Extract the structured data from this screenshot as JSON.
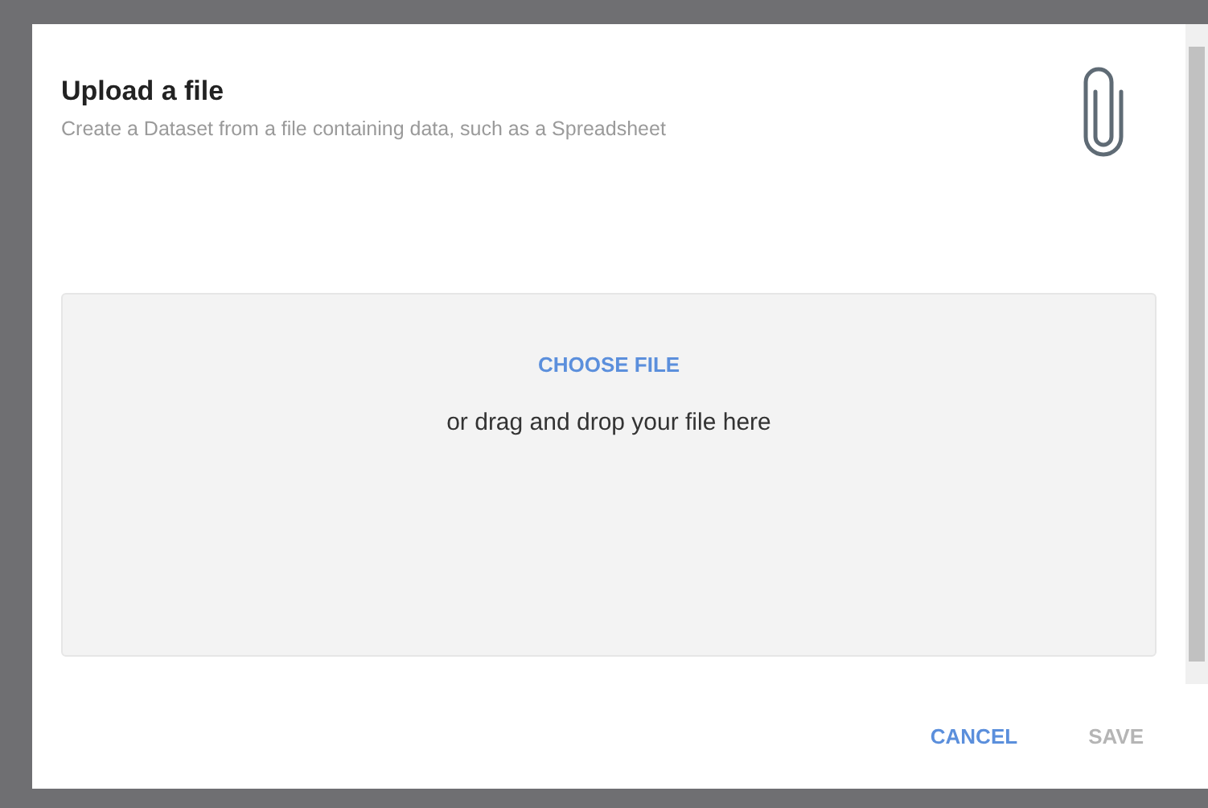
{
  "dialog": {
    "title": "Upload a file",
    "subtitle": "Create a Dataset from a file containing data, such as a Spreadsheet"
  },
  "dropzone": {
    "choose_label": "CHOOSE FILE",
    "hint": "or drag and drop your file here"
  },
  "buttons": [
    {
      "label": "CANCEL",
      "disabled": false
    },
    {
      "label": "SAVE",
      "disabled": true
    }
  ]
}
